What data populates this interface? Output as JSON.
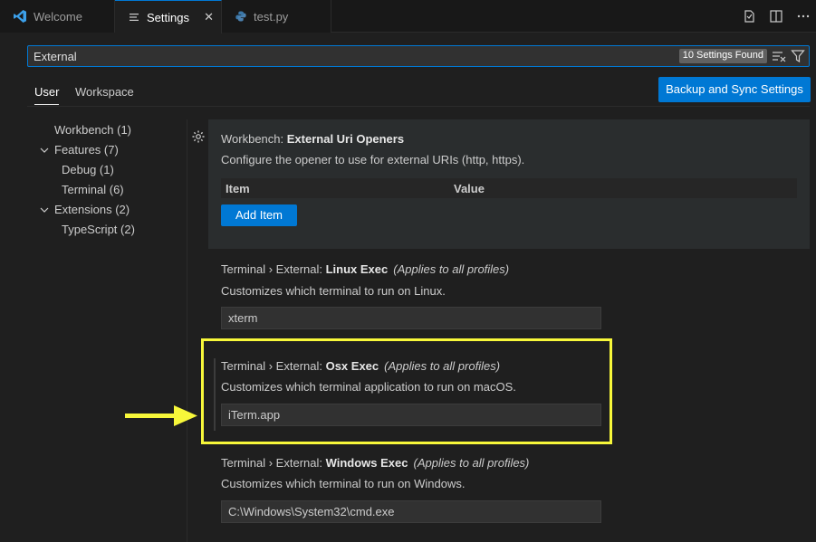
{
  "tabs": [
    {
      "label": "Welcome",
      "icon": "vscode-icon"
    },
    {
      "label": "Settings",
      "icon": "settings-lines-icon",
      "active": true
    },
    {
      "label": "test.py",
      "icon": "python-icon"
    }
  ],
  "tab_close_glyph": "✕",
  "search": {
    "value": "External",
    "results_badge": "10 Settings Found"
  },
  "scopes": {
    "user": "User",
    "workspace": "Workspace"
  },
  "sync_button": "Backup and Sync Settings",
  "toc": [
    {
      "label": "Workbench (1)"
    },
    {
      "label": "Features (7)",
      "expanded": true
    },
    {
      "label": "Debug (1)"
    },
    {
      "label": "Terminal (6)"
    },
    {
      "label": "Extensions (2)",
      "expanded": true
    },
    {
      "label": "TypeScript (2)"
    }
  ],
  "settings": [
    {
      "category": "Workbench: ",
      "name": "External Uri Openers",
      "description": "Configure the opener to use for external URIs (http, https).",
      "table_headers": [
        "Item",
        "Value"
      ],
      "add_button": "Add Item"
    },
    {
      "category": "Terminal › External: ",
      "name": "Linux Exec",
      "scope_note": "(Applies to all profiles)",
      "description": "Customizes which terminal to run on Linux.",
      "value": "xterm"
    },
    {
      "category": "Terminal › External: ",
      "name": "Osx Exec",
      "scope_note": "(Applies to all profiles)",
      "description": "Customizes which terminal application to run on macOS.",
      "value": "iTerm.app"
    },
    {
      "category": "Terminal › External: ",
      "name": "Windows Exec",
      "scope_note": "(Applies to all profiles)",
      "description": "Customizes which terminal to run on Windows.",
      "value": "C:\\Windows\\System32\\cmd.exe"
    }
  ],
  "colors": {
    "accent": "#0078d4",
    "highlight": "#f7f73a",
    "background": "#1f1f1f"
  }
}
